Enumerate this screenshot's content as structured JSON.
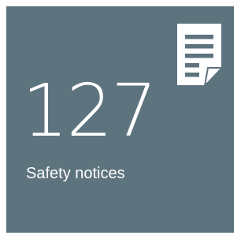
{
  "tile": {
    "count": "127",
    "label": "Safety notices",
    "icon": "document-list-icon",
    "background_color": "#5d737e",
    "text_color": "#ffffff"
  }
}
